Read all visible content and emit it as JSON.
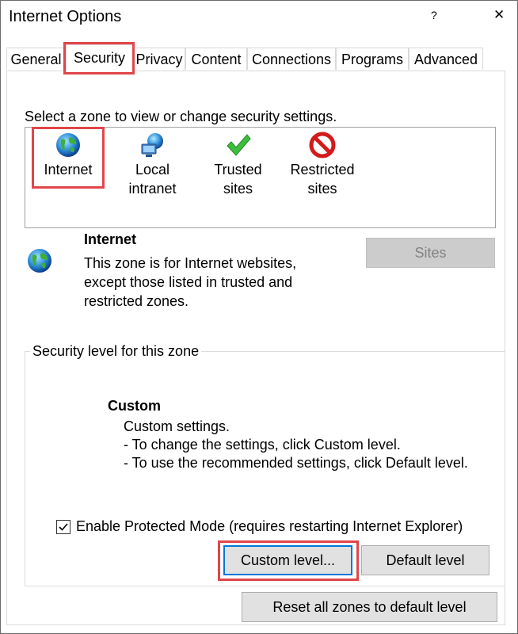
{
  "window": {
    "title": "Internet Options",
    "help_label": "?",
    "close_label": "✕"
  },
  "tabs": [
    {
      "label": "General"
    },
    {
      "label": "Security",
      "active": true
    },
    {
      "label": "Privacy"
    },
    {
      "label": "Content"
    },
    {
      "label": "Connections"
    },
    {
      "label": "Programs"
    },
    {
      "label": "Advanced"
    }
  ],
  "zones": {
    "prompt": "Select a zone to view or change security settings.",
    "items": [
      {
        "label": "Internet",
        "icon": "globe-icon",
        "selected": true
      },
      {
        "label": "Local\nintranet",
        "icon": "intranet-icon"
      },
      {
        "label": "Trusted\nsites",
        "icon": "checkmark-icon"
      },
      {
        "label": "Restricted\nsites",
        "icon": "restricted-icon"
      }
    ]
  },
  "zone_info": {
    "name": "Internet",
    "description": "This zone is for Internet websites, except those listed in trusted and restricted zones.",
    "sites_button": "Sites"
  },
  "security_level": {
    "group_label": "Security level for this zone",
    "level_title": "Custom",
    "level_lines": [
      "Custom settings.",
      "- To change the settings, click Custom level.",
      "- To use the recommended settings, click Default level."
    ],
    "protected_mode_label": "Enable Protected Mode (requires restarting Internet Explorer)",
    "protected_mode_checked": true,
    "custom_level_button": "Custom level...",
    "default_level_button": "Default level"
  },
  "reset_button": "Reset all zones to default level",
  "colors": {
    "highlight": "#e0454a",
    "focus": "#0078d7"
  }
}
